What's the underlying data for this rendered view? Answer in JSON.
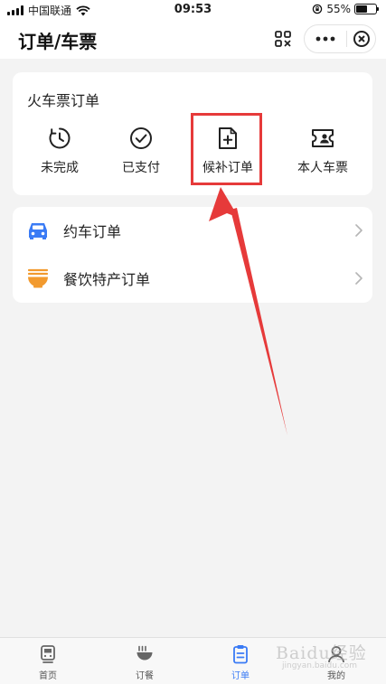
{
  "status_bar": {
    "carrier": "中国联通",
    "time": "09:53",
    "battery": "55%",
    "battery_level": 0.55
  },
  "nav": {
    "title": "订单/车票",
    "icons": [
      "scan-icon",
      "more-icon",
      "close-icon"
    ]
  },
  "train_card": {
    "title": "火车票订单",
    "entries": [
      {
        "label": "未完成",
        "icon": "clock-icon"
      },
      {
        "label": "已支付",
        "icon": "check-circle-icon"
      },
      {
        "label": "候补订单",
        "icon": "document-plus-icon"
      },
      {
        "label": "本人车票",
        "icon": "id-ticket-icon"
      }
    ]
  },
  "list": [
    {
      "label": "约车订单",
      "icon": "car-icon",
      "icon_color": "#3a7bf5"
    },
    {
      "label": "餐饮特产订单",
      "icon": "noodle-bowl-icon",
      "icon_color": "#f29a2e"
    }
  ],
  "tabbar": {
    "tabs": [
      {
        "label": "首页",
        "icon": "train-icon"
      },
      {
        "label": "订餐",
        "icon": "bowl-icon"
      },
      {
        "label": "订单",
        "icon": "clipboard-icon",
        "active": true
      },
      {
        "label": "我的",
        "icon": "user-icon"
      }
    ]
  },
  "annotation": {
    "color": "#e63a3a"
  },
  "watermark": {
    "text": "Baidu经验",
    "sub": "jingyan.baidu.com"
  },
  "colors": {
    "accent": "#3a7bf5",
    "highlight": "#e63a3a",
    "background": "#f3f3f3"
  }
}
